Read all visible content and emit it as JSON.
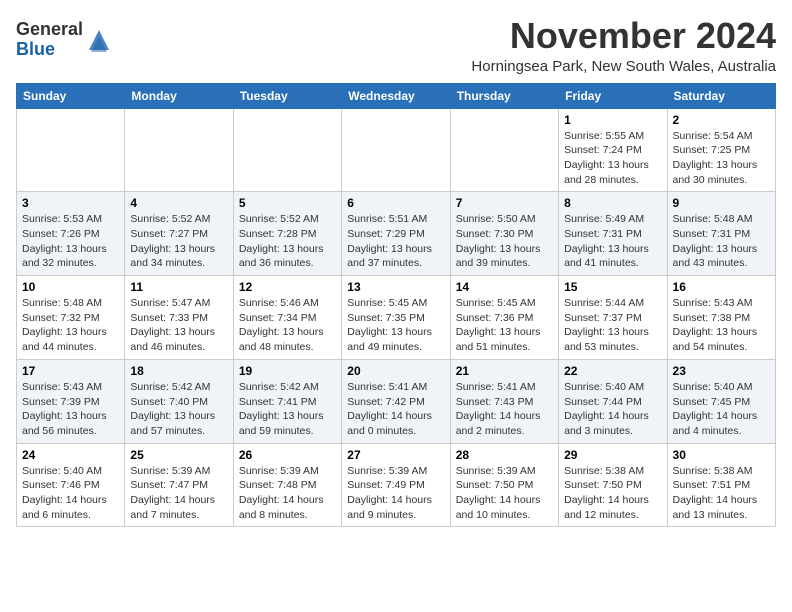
{
  "header": {
    "logo_general": "General",
    "logo_blue": "Blue",
    "month_title": "November 2024",
    "location": "Horningsea Park, New South Wales, Australia"
  },
  "days_of_week": [
    "Sunday",
    "Monday",
    "Tuesday",
    "Wednesday",
    "Thursday",
    "Friday",
    "Saturday"
  ],
  "weeks": [
    [
      {
        "day": "",
        "info": ""
      },
      {
        "day": "",
        "info": ""
      },
      {
        "day": "",
        "info": ""
      },
      {
        "day": "",
        "info": ""
      },
      {
        "day": "",
        "info": ""
      },
      {
        "day": "1",
        "info": "Sunrise: 5:55 AM\nSunset: 7:24 PM\nDaylight: 13 hours\nand 28 minutes."
      },
      {
        "day": "2",
        "info": "Sunrise: 5:54 AM\nSunset: 7:25 PM\nDaylight: 13 hours\nand 30 minutes."
      }
    ],
    [
      {
        "day": "3",
        "info": "Sunrise: 5:53 AM\nSunset: 7:26 PM\nDaylight: 13 hours\nand 32 minutes."
      },
      {
        "day": "4",
        "info": "Sunrise: 5:52 AM\nSunset: 7:27 PM\nDaylight: 13 hours\nand 34 minutes."
      },
      {
        "day": "5",
        "info": "Sunrise: 5:52 AM\nSunset: 7:28 PM\nDaylight: 13 hours\nand 36 minutes."
      },
      {
        "day": "6",
        "info": "Sunrise: 5:51 AM\nSunset: 7:29 PM\nDaylight: 13 hours\nand 37 minutes."
      },
      {
        "day": "7",
        "info": "Sunrise: 5:50 AM\nSunset: 7:30 PM\nDaylight: 13 hours\nand 39 minutes."
      },
      {
        "day": "8",
        "info": "Sunrise: 5:49 AM\nSunset: 7:31 PM\nDaylight: 13 hours\nand 41 minutes."
      },
      {
        "day": "9",
        "info": "Sunrise: 5:48 AM\nSunset: 7:31 PM\nDaylight: 13 hours\nand 43 minutes."
      }
    ],
    [
      {
        "day": "10",
        "info": "Sunrise: 5:48 AM\nSunset: 7:32 PM\nDaylight: 13 hours\nand 44 minutes."
      },
      {
        "day": "11",
        "info": "Sunrise: 5:47 AM\nSunset: 7:33 PM\nDaylight: 13 hours\nand 46 minutes."
      },
      {
        "day": "12",
        "info": "Sunrise: 5:46 AM\nSunset: 7:34 PM\nDaylight: 13 hours\nand 48 minutes."
      },
      {
        "day": "13",
        "info": "Sunrise: 5:45 AM\nSunset: 7:35 PM\nDaylight: 13 hours\nand 49 minutes."
      },
      {
        "day": "14",
        "info": "Sunrise: 5:45 AM\nSunset: 7:36 PM\nDaylight: 13 hours\nand 51 minutes."
      },
      {
        "day": "15",
        "info": "Sunrise: 5:44 AM\nSunset: 7:37 PM\nDaylight: 13 hours\nand 53 minutes."
      },
      {
        "day": "16",
        "info": "Sunrise: 5:43 AM\nSunset: 7:38 PM\nDaylight: 13 hours\nand 54 minutes."
      }
    ],
    [
      {
        "day": "17",
        "info": "Sunrise: 5:43 AM\nSunset: 7:39 PM\nDaylight: 13 hours\nand 56 minutes."
      },
      {
        "day": "18",
        "info": "Sunrise: 5:42 AM\nSunset: 7:40 PM\nDaylight: 13 hours\nand 57 minutes."
      },
      {
        "day": "19",
        "info": "Sunrise: 5:42 AM\nSunset: 7:41 PM\nDaylight: 13 hours\nand 59 minutes."
      },
      {
        "day": "20",
        "info": "Sunrise: 5:41 AM\nSunset: 7:42 PM\nDaylight: 14 hours\nand 0 minutes."
      },
      {
        "day": "21",
        "info": "Sunrise: 5:41 AM\nSunset: 7:43 PM\nDaylight: 14 hours\nand 2 minutes."
      },
      {
        "day": "22",
        "info": "Sunrise: 5:40 AM\nSunset: 7:44 PM\nDaylight: 14 hours\nand 3 minutes."
      },
      {
        "day": "23",
        "info": "Sunrise: 5:40 AM\nSunset: 7:45 PM\nDaylight: 14 hours\nand 4 minutes."
      }
    ],
    [
      {
        "day": "24",
        "info": "Sunrise: 5:40 AM\nSunset: 7:46 PM\nDaylight: 14 hours\nand 6 minutes."
      },
      {
        "day": "25",
        "info": "Sunrise: 5:39 AM\nSunset: 7:47 PM\nDaylight: 14 hours\nand 7 minutes."
      },
      {
        "day": "26",
        "info": "Sunrise: 5:39 AM\nSunset: 7:48 PM\nDaylight: 14 hours\nand 8 minutes."
      },
      {
        "day": "27",
        "info": "Sunrise: 5:39 AM\nSunset: 7:49 PM\nDaylight: 14 hours\nand 9 minutes."
      },
      {
        "day": "28",
        "info": "Sunrise: 5:39 AM\nSunset: 7:50 PM\nDaylight: 14 hours\nand 10 minutes."
      },
      {
        "day": "29",
        "info": "Sunrise: 5:38 AM\nSunset: 7:50 PM\nDaylight: 14 hours\nand 12 minutes."
      },
      {
        "day": "30",
        "info": "Sunrise: 5:38 AM\nSunset: 7:51 PM\nDaylight: 14 hours\nand 13 minutes."
      }
    ]
  ]
}
